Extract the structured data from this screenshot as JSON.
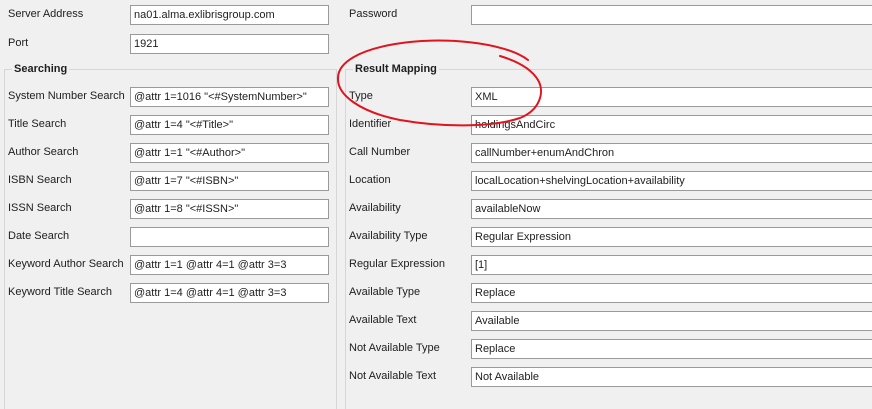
{
  "connection": {
    "server_address_label": "Server Address",
    "server_address_value": "na01.alma.exlibrisgroup.com",
    "port_label": "Port",
    "port_value": "1921",
    "password_label": "Password",
    "password_value": ""
  },
  "searching": {
    "title": "Searching",
    "rows": [
      {
        "label": "System Number Search",
        "value": "@attr 1=1016 \"<#SystemNumber>\""
      },
      {
        "label": "Title Search",
        "value": "@attr 1=4 \"<#Title>\""
      },
      {
        "label": "Author Search",
        "value": "@attr 1=1 \"<#Author>\""
      },
      {
        "label": "ISBN Search",
        "value": "@attr 1=7 \"<#ISBN>\""
      },
      {
        "label": "ISSN Search",
        "value": "@attr 1=8 \"<#ISSN>\""
      },
      {
        "label": "Date Search",
        "value": ""
      },
      {
        "label": "Keyword Author Search",
        "value": "@attr 1=1 @attr 4=1 @attr 3=3"
      },
      {
        "label": "Keyword Title Search",
        "value": "@attr 1=4 @attr 4=1 @attr 3=3"
      }
    ]
  },
  "result_mapping": {
    "title": "Result Mapping",
    "rows": [
      {
        "label": "Type",
        "value": "XML"
      },
      {
        "label": "Identifier",
        "value": "holdingsAndCirc"
      },
      {
        "label": "Call Number",
        "value": "callNumber+enumAndChron"
      },
      {
        "label": "Location",
        "value": "localLocation+shelvingLocation+availability"
      },
      {
        "label": "Availability",
        "value": "availableNow"
      },
      {
        "label": "Availability Type",
        "value": "Regular Expression"
      },
      {
        "label": "Regular Expression",
        "value": "[1]"
      },
      {
        "label": "Available Type",
        "value": "Replace"
      },
      {
        "label": "Available Text",
        "value": "Available"
      },
      {
        "label": "Not Available Type",
        "value": "Replace"
      },
      {
        "label": "Not Available Text",
        "value": "Not Available"
      }
    ]
  },
  "annotation": {
    "color": "#e0141e"
  }
}
